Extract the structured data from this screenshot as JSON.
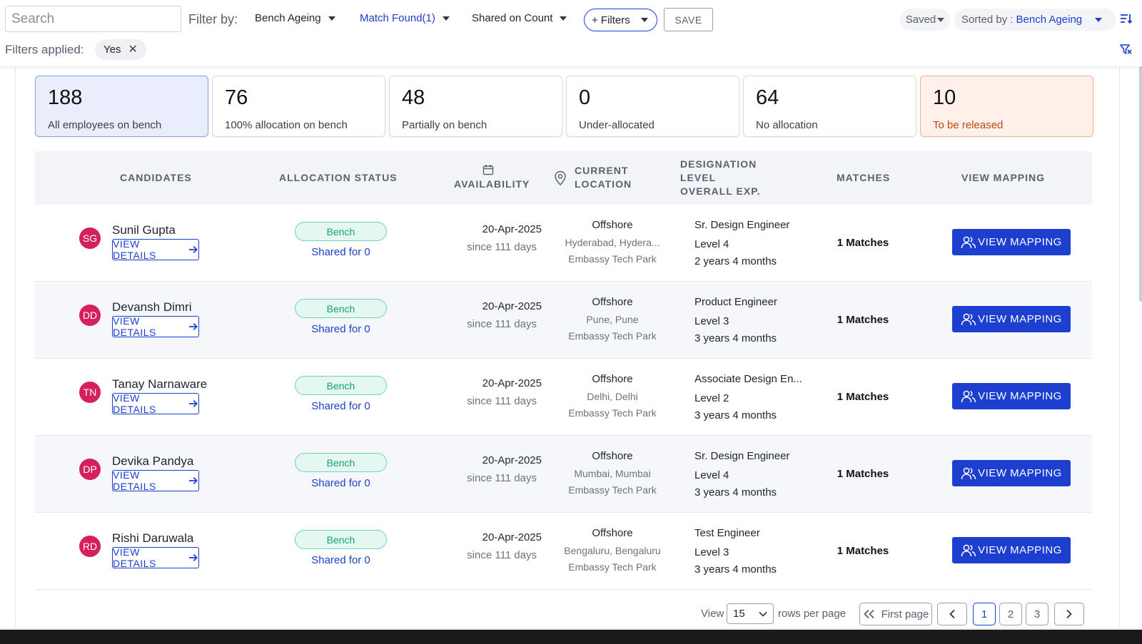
{
  "search": {
    "placeholder": "Search"
  },
  "filter_bar": {
    "filter_by_label": "Filter by:",
    "bench_ageing": "Bench Ageing",
    "match_found": "Match Found(1)",
    "shared_on_count": "Shared on Count",
    "more_filters": "+ Filters",
    "save_label": "SAVE",
    "saved_label": "Saved",
    "sorted_by_label": "Sorted by :",
    "sorted_by_value": "Bench Ageing"
  },
  "filters_applied": {
    "label": "Filters applied:",
    "chip": "Yes"
  },
  "stat_cards": [
    {
      "value": "188",
      "label": "All employees on bench"
    },
    {
      "value": "76",
      "label": "100% allocation on bench"
    },
    {
      "value": "48",
      "label": "Partially on bench"
    },
    {
      "value": "0",
      "label": "Under-allocated"
    },
    {
      "value": "64",
      "label": "No allocation"
    },
    {
      "value": "10",
      "label": "To be released"
    }
  ],
  "table": {
    "headers": {
      "candidates": "CANDIDATES",
      "allocation_status": "ALLOCATION STATUS",
      "availability": "AVAILABILITY",
      "location_1": "CURRENT",
      "location_2": "LOCATION",
      "designation_1": "DESIGNATION",
      "designation_2": "LEVEL",
      "designation_3": "OVERALL EXP.",
      "matches": "MATCHES",
      "view_mapping": "VIEW MAPPING"
    },
    "view_details_label": "VIEW DETAILS",
    "view_mapping_label": "VIEW MAPPING",
    "rows": [
      {
        "initials": "SG",
        "name": "Sunil Gupta",
        "status": "Bench",
        "shared": "Shared for 0",
        "date": "20-Apr-2025",
        "since": "since 111 days",
        "loc_type": "Offshore",
        "city": "Hyderabad, Hydera...",
        "park": "Embassy Tech Park",
        "designation": "Sr. Design Engineer",
        "level": "Level 4",
        "exp": "2 years 4 months",
        "matches": "1 Matches"
      },
      {
        "initials": "DD",
        "name": "Devansh Dimri",
        "status": "Bench",
        "shared": "Shared for 0",
        "date": "20-Apr-2025",
        "since": "since 111 days",
        "loc_type": "Offshore",
        "city": "Pune, Pune",
        "park": "Embassy Tech Park",
        "designation": "Product Engineer",
        "level": "Level 3",
        "exp": "3 years 4 months",
        "matches": "1 Matches"
      },
      {
        "initials": "TN",
        "name": "Tanay Narnaware",
        "status": "Bench",
        "shared": "Shared for 0",
        "date": "20-Apr-2025",
        "since": "since 111 days",
        "loc_type": "Offshore",
        "city": "Delhi, Delhi",
        "park": "Embassy Tech Park",
        "designation": "Associate Design En...",
        "level": "Level 2",
        "exp": "3 years 4 months",
        "matches": "1 Matches"
      },
      {
        "initials": "DP",
        "name": "Devika Pandya",
        "status": "Bench",
        "shared": "Shared for 0",
        "date": "20-Apr-2025",
        "since": "since 111 days",
        "loc_type": "Offshore",
        "city": "Mumbai, Mumbai",
        "park": "Embassy Tech Park",
        "designation": "Sr. Design Engineer",
        "level": "Level 4",
        "exp": "3 years 4 months",
        "matches": "1 Matches"
      },
      {
        "initials": "RD",
        "name": "Rishi Daruwala",
        "status": "Bench",
        "shared": "Shared for 0",
        "date": "20-Apr-2025",
        "since": "since 111 days",
        "loc_type": "Offshore",
        "city": "Bengaluru, Bengaluru",
        "park": "Embassy Tech Park",
        "designation": "Test Engineer",
        "level": "Level 3",
        "exp": "3 years 4 months",
        "matches": "1 Matches"
      }
    ]
  },
  "pagination": {
    "view_label": "View",
    "rows_value": "15",
    "rows_per_page_label": "rows per page",
    "first_page_label": "First page",
    "pages": [
      "1",
      "2",
      "3"
    ],
    "current_page": "1"
  },
  "colors": {
    "primary": "#1d3fcf",
    "avatar": "#d61f5d",
    "bench_green": "#16a07a",
    "release_orange": "#c2460f"
  }
}
